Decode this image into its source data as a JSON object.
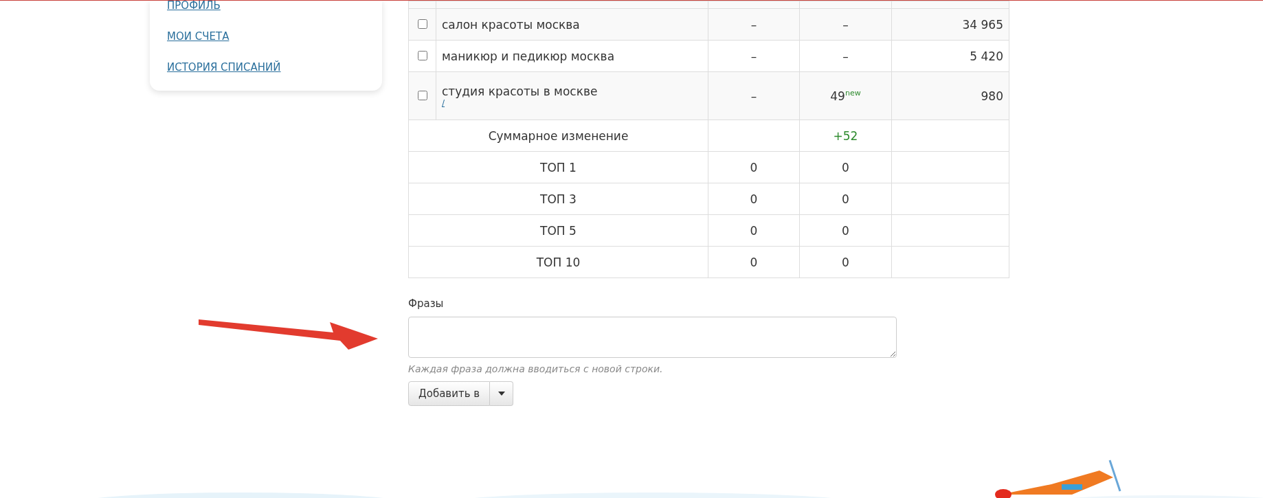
{
  "sidebar": {
    "links": [
      {
        "label": "ПРОФИЛЬ"
      },
      {
        "label": "МОИ СЧЕТА"
      },
      {
        "label": "ИСТОРИЯ СПИСАНИЙ"
      }
    ]
  },
  "table": {
    "rows": [
      {
        "checked": false,
        "phrase": "салон красоты москва",
        "column_3": "–",
        "column_4": "–",
        "column_5": "34 965"
      },
      {
        "checked": false,
        "phrase": "маникюр и педикюр москва",
        "column_3": "–",
        "column_4": "–",
        "column_5": "5 420"
      },
      {
        "checked": false,
        "phrase": "студия красоты в москве",
        "link": "/",
        "column_3": "–",
        "column_4": "49",
        "column_4_badge": "new",
        "column_5": "980"
      }
    ],
    "summary": [
      {
        "label": "Суммарное изменение",
        "column_4": "+52",
        "positive": true
      },
      {
        "label": "ТОП 1",
        "column_3": "0",
        "column_4": "0",
        "positive": false
      },
      {
        "label": "ТОП 3",
        "column_3": "0",
        "column_4": "0",
        "positive": false
      },
      {
        "label": "ТОП 5",
        "column_3": "0",
        "column_4": "0",
        "positive": false
      },
      {
        "label": "ТОП 10",
        "column_3": "0",
        "column_4": "0",
        "positive": false
      }
    ]
  },
  "phrases_field": {
    "label": "Фразы",
    "help": "Каждая фраза должна вводиться с новой строки."
  },
  "add_button": {
    "label": "Добавить в"
  }
}
